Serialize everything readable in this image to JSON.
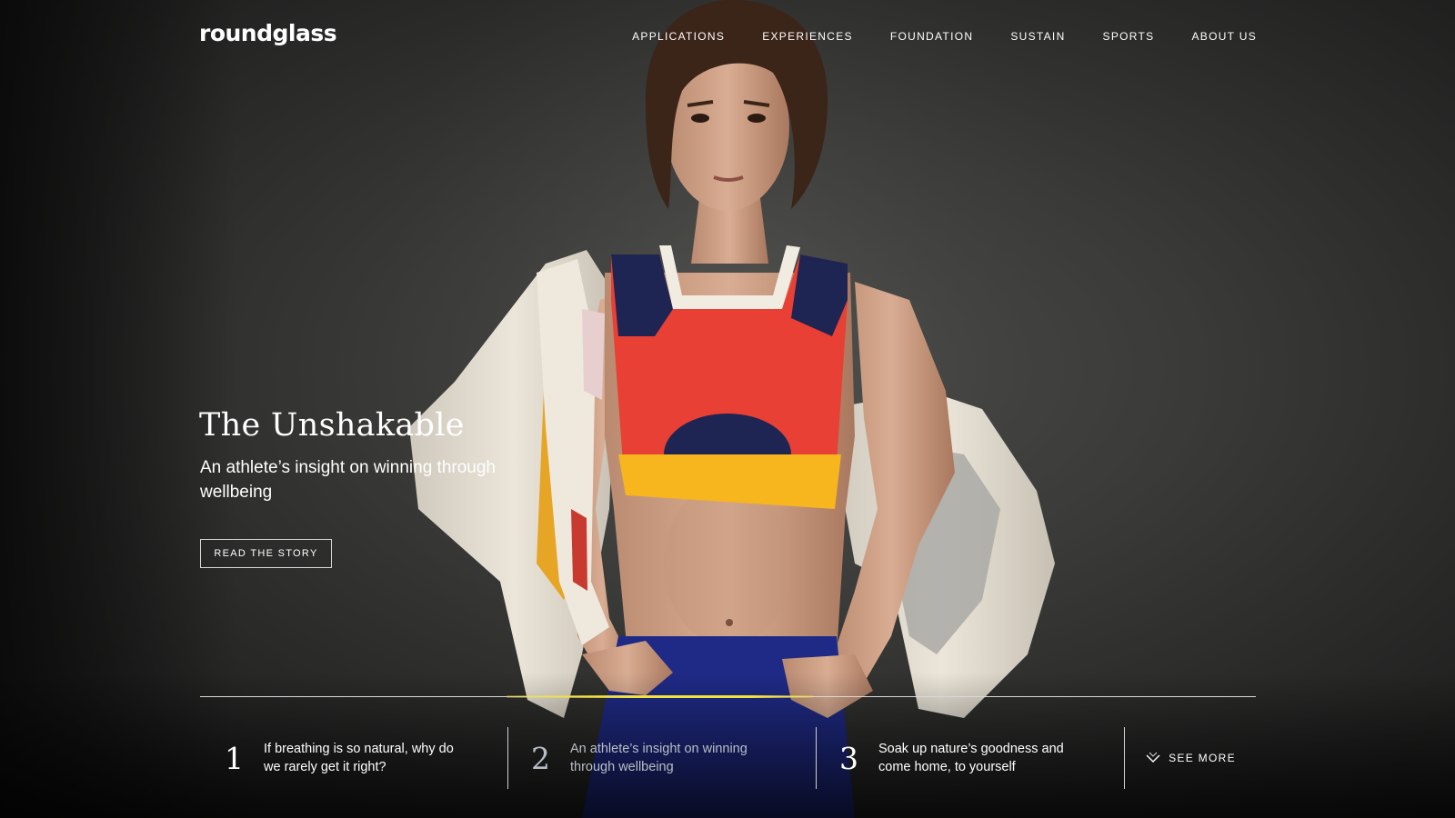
{
  "brand": {
    "logo_text": "roundglass"
  },
  "nav": {
    "items": [
      {
        "label": "APPLICATIONS"
      },
      {
        "label": "EXPERIENCES"
      },
      {
        "label": "FOUNDATION"
      },
      {
        "label": "SUSTAIN"
      },
      {
        "label": "SPORTS"
      },
      {
        "label": "ABOUT US"
      }
    ]
  },
  "hero": {
    "title": "The Unshakable",
    "subtitle": "An athlete’s insight on winning through wellbeing",
    "cta_label": "READ THE STORY",
    "image_subject": "athlete-portrait"
  },
  "carousel": {
    "progress_fraction": 0.29,
    "active_index": 1,
    "accent_color": "#f2e23a"
  },
  "stories": [
    {
      "number": "1",
      "text": "If breathing is so natural, why do we rarely get it right?"
    },
    {
      "number": "2",
      "text": "An athlete’s insight on winning through wellbeing"
    },
    {
      "number": "3",
      "text": "Soak up nature’s goodness and come home, to yourself"
    }
  ],
  "see_more": {
    "label": "SEE MORE",
    "icon": "chevron-down-icon"
  }
}
